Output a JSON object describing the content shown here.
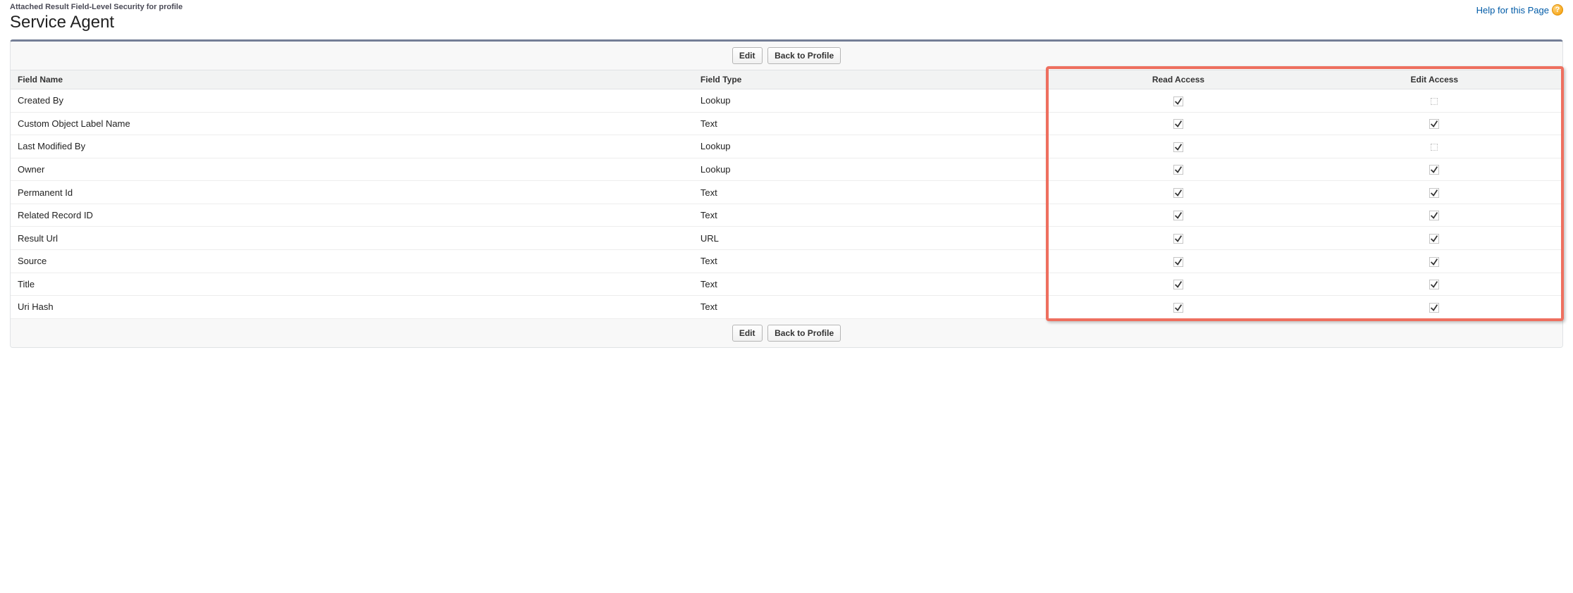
{
  "header": {
    "subtitle": "Attached Result Field-Level Security for profile",
    "title": "Service Agent",
    "help_label": "Help for this Page",
    "help_icon_glyph": "?"
  },
  "buttons": {
    "edit": "Edit",
    "back": "Back to Profile"
  },
  "columns": {
    "field_name": "Field Name",
    "field_type": "Field Type",
    "read_access": "Read Access",
    "edit_access": "Edit Access"
  },
  "rows": [
    {
      "name": "Created By",
      "type": "Lookup",
      "read": true,
      "edit": false
    },
    {
      "name": "Custom Object Label Name",
      "type": "Text",
      "read": true,
      "edit": true
    },
    {
      "name": "Last Modified By",
      "type": "Lookup",
      "read": true,
      "edit": false
    },
    {
      "name": "Owner",
      "type": "Lookup",
      "read": true,
      "edit": true
    },
    {
      "name": "Permanent Id",
      "type": "Text",
      "read": true,
      "edit": true
    },
    {
      "name": "Related Record ID",
      "type": "Text",
      "read": true,
      "edit": true
    },
    {
      "name": "Result Url",
      "type": "URL",
      "read": true,
      "edit": true
    },
    {
      "name": "Source",
      "type": "Text",
      "read": true,
      "edit": true
    },
    {
      "name": "Title",
      "type": "Text",
      "read": true,
      "edit": true
    },
    {
      "name": "Uri Hash",
      "type": "Text",
      "read": true,
      "edit": true
    }
  ]
}
